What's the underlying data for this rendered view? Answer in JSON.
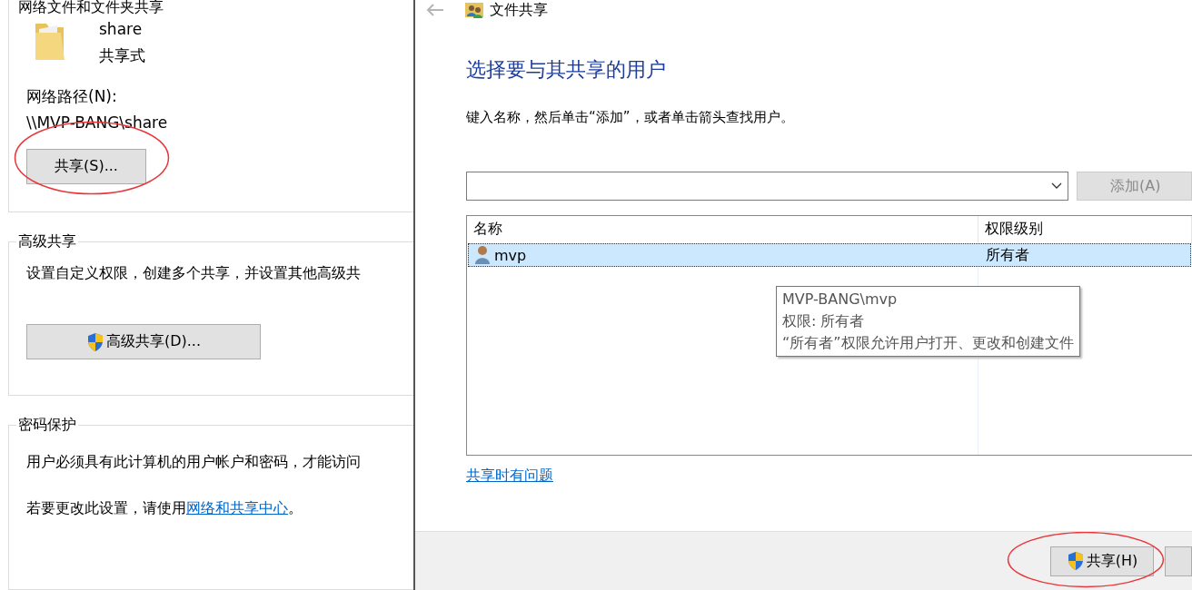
{
  "left_panel": {
    "groups": [
      {
        "kind": "file",
        "title": "网络文件和文件夹共享",
        "name": "share",
        "status": "共享式",
        "path_label": "网络路径(N):",
        "path": "\\\\MVP-BANG\\share",
        "button": {
          "label": "共享(S)...",
          "shield": false,
          "circled": true
        }
      },
      {
        "kind": "advanced",
        "title": "高级共享",
        "text": "设置自定义权限，创建多个共享，并设置其他高级共",
        "button": {
          "label": "高级共享(D)...",
          "shield": true,
          "circled": false
        }
      },
      {
        "kind": "password",
        "title": "密码保护",
        "text": "用户必须具有此计算机的用户帐户和密码，才能访问",
        "setting_text": "若要更改此设置，请使用",
        "link": "网络和共享中心",
        "tail": "。"
      }
    ]
  },
  "dialog": {
    "title": "文件共享",
    "heading": "选择要与其共享的用户",
    "instruction": "键入名称，然后单击“添加”，或者单击箭头查找用户。",
    "add_button": {
      "label": "添加(A)",
      "disabled": true
    },
    "table": {
      "columns": [
        "名称",
        "权限级别"
      ],
      "rows": [
        {
          "name": "mvp",
          "permission": "所有者",
          "selected": true
        }
      ]
    },
    "tooltip": [
      "MVP-BANG\\mvp",
      "权限: 所有者",
      "“所有者”权限允许用户打开、更改和创建文件"
    ],
    "help_link": "共享时有问题",
    "footer_buttons": [
      {
        "label": "共享(H)",
        "shield": true,
        "circled": true
      },
      {
        "kind": "partial"
      }
    ]
  }
}
